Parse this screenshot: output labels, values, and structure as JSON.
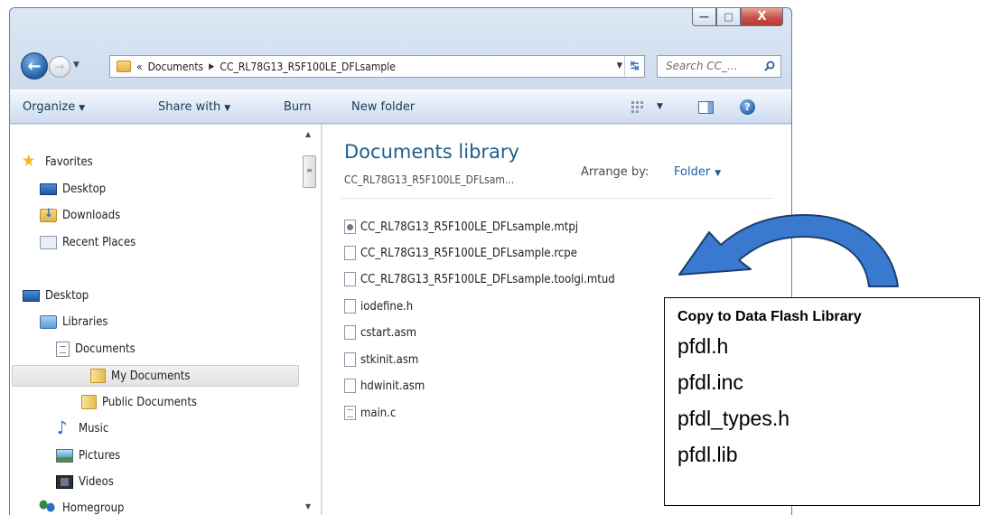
{
  "window": {
    "caption": {
      "minimize": "—",
      "maximize": "□",
      "close": "X"
    }
  },
  "address": {
    "overflow": "«",
    "segments": [
      "Documents",
      "CC_RL78G13_R5F100LE_DFLsample"
    ],
    "search_placeholder": "Search CC_..."
  },
  "toolbar": {
    "organize": "Organize",
    "share_with": "Share with",
    "burn": "Burn",
    "new_folder": "New folder"
  },
  "nav": {
    "favorites": "Favorites",
    "desktop_fav": "Desktop",
    "downloads": "Downloads",
    "recent_places": "Recent Places",
    "desktop": "Desktop",
    "libraries": "Libraries",
    "documents": "Documents",
    "my_documents": "My Documents",
    "public_documents": "Public Documents",
    "music": "Music",
    "pictures": "Pictures",
    "videos": "Videos",
    "homegroup": "Homegroup"
  },
  "content": {
    "library_title": "Documents library",
    "library_subtitle": "CC_RL78G13_R5F100LE_DFLsam...",
    "arrange_label": "Arrange by:",
    "arrange_value": "Folder",
    "files": [
      {
        "name": "CC_RL78G13_R5F100LE_DFLsample.mtpj",
        "icon": "project-file-icon"
      },
      {
        "name": "CC_RL78G13_R5F100LE_DFLsample.rcpe",
        "icon": "file-icon"
      },
      {
        "name": "CC_RL78G13_R5F100LE_DFLsample.toolgi.mtud",
        "icon": "file-icon"
      },
      {
        "name": "iodefine.h",
        "icon": "file-icon"
      },
      {
        "name": "cstart.asm",
        "icon": "file-icon"
      },
      {
        "name": "stkinit.asm",
        "icon": "file-icon"
      },
      {
        "name": "hdwinit.asm",
        "icon": "file-icon"
      },
      {
        "name": "main.c",
        "icon": "text-file-icon"
      }
    ]
  },
  "callout": {
    "title": "Copy to Data Flash Library",
    "items": [
      "pfdl.h",
      "pfdl.inc",
      "pfdl_types.h",
      "pfdl.lib"
    ]
  },
  "colors": {
    "accent": "#1f5da8",
    "title_text": "#1e5f8a",
    "arrow_fill": "#3a79d0",
    "arrow_stroke": "#1d3e6e"
  }
}
